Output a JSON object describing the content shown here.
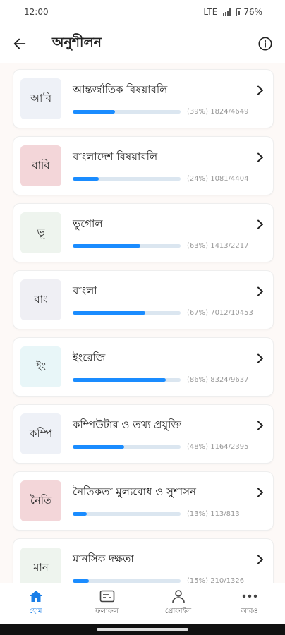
{
  "status": {
    "time": "12:00",
    "network": "LTE",
    "battery": "76%"
  },
  "header": {
    "title": "অনুশীলন",
    "back_icon": "arrow-left-icon",
    "info_icon": "info-icon"
  },
  "accent_color": "#1a8cff",
  "subjects": [
    {
      "badge": "আবি",
      "badge_color": "#eef1f7",
      "title": "আন্তর্জাতিক বিষয়াবলি",
      "progress": 0.39,
      "stat": "(39%) 1824/4649"
    },
    {
      "badge": "বাবি",
      "badge_color": "#f3d6d9",
      "title": "বাংলাদেশ বিষয়াবলি",
      "progress": 0.24,
      "stat": "(24%) 1081/4404"
    },
    {
      "badge": "ভূ",
      "badge_color": "#eef4ee",
      "title": "ভুগোল",
      "progress": 0.63,
      "stat": "(63%) 1413/2217"
    },
    {
      "badge": "বাং",
      "badge_color": "#efeff4",
      "title": "বাংলা",
      "progress": 0.67,
      "stat": "(67%) 7012/10453"
    },
    {
      "badge": "ইং",
      "badge_color": "#e8f6f8",
      "title": "ইংরেজি",
      "progress": 0.86,
      "stat": "(86%) 8324/9637"
    },
    {
      "badge": "কম্পি",
      "badge_color": "#eef1f7",
      "title": "কম্পিউটার ও তথ্য প্রযুক্তি",
      "progress": 0.48,
      "stat": "(48%) 1164/2395"
    },
    {
      "badge": "নৈতি",
      "badge_color": "#f3d6d9",
      "title": "নৈতিকতা মুল্যবোধ ও সুশাসন",
      "progress": 0.13,
      "stat": "(13%) 113/813"
    },
    {
      "badge": "মান",
      "badge_color": "#eef4ee",
      "title": "মানসিক দক্ষতা",
      "progress": 0.15,
      "stat": "(15%) 210/1326"
    }
  ],
  "bottom_nav": [
    {
      "label": "হোম",
      "icon": "home-icon",
      "active": true
    },
    {
      "label": "ফলাফল",
      "icon": "results-icon",
      "active": false
    },
    {
      "label": "প্রোফাইল",
      "icon": "profile-icon",
      "active": false
    },
    {
      "label": "আরও",
      "icon": "more-icon",
      "active": false
    }
  ]
}
